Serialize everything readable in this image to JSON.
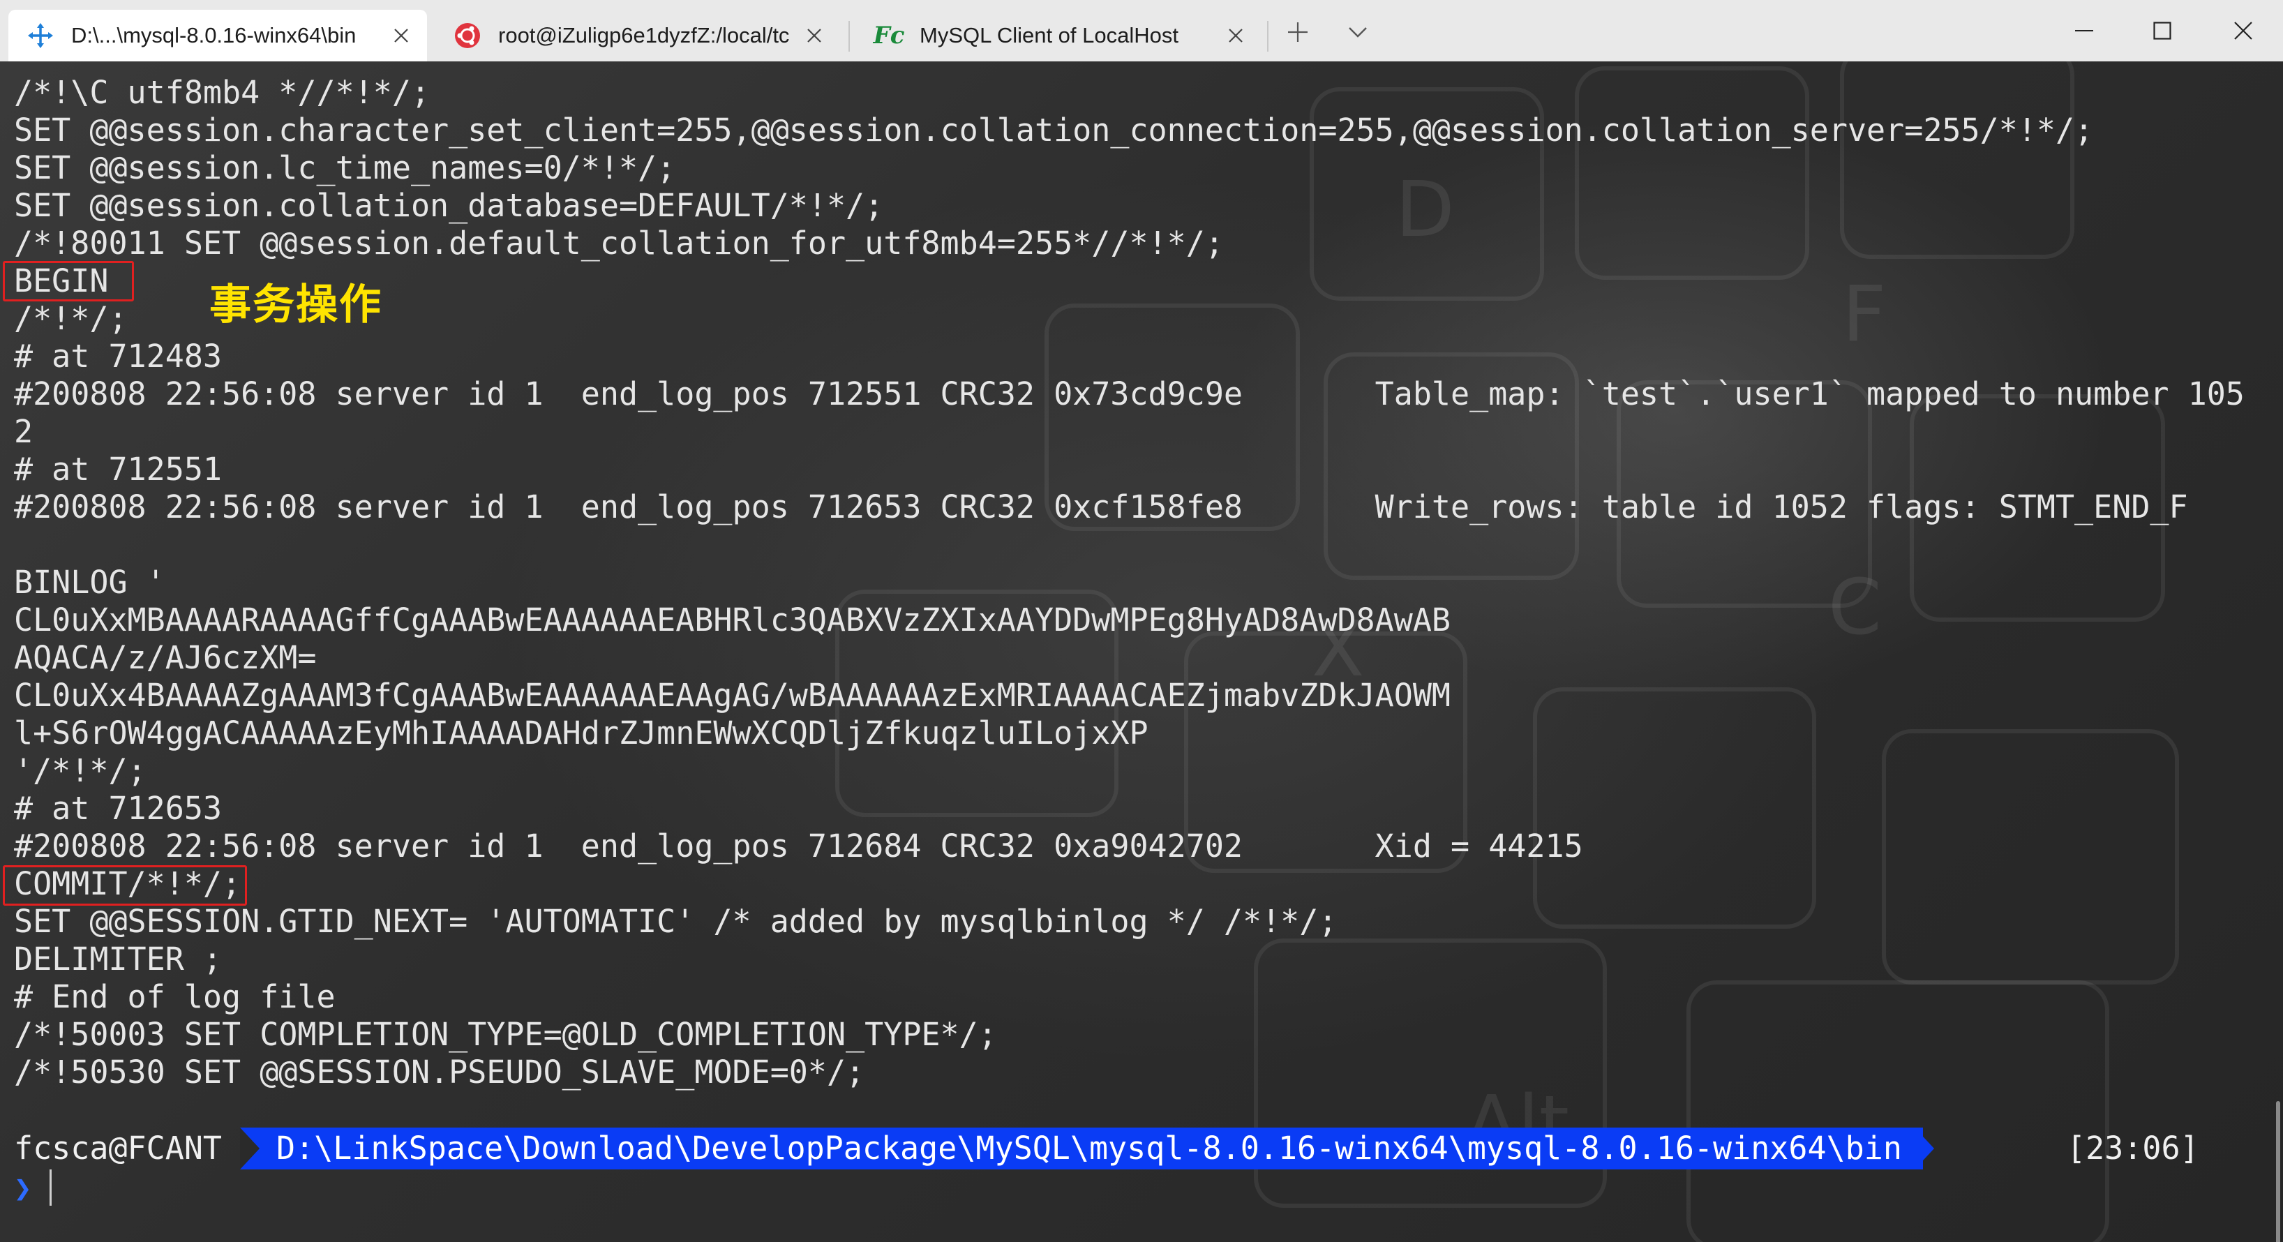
{
  "tabs": [
    {
      "label": "D:\\...\\mysql-8.0.16-winx64\\bin",
      "icon": "move-arrows-icon",
      "active": true
    },
    {
      "label": "root@iZuligp6e1dyzfZ:/local/tc",
      "icon": "ubuntu-icon",
      "active": false
    },
    {
      "label": "MySQL Client of LocalHost",
      "icon": "fc-logo-icon",
      "fc_text": "Fc",
      "active": false
    }
  ],
  "tabbar": {
    "new_tab": "+",
    "dropdown": "⌵"
  },
  "window": {
    "minimize": "—",
    "maximize": "☐",
    "close": "✕"
  },
  "terminal_lines": [
    "/*!\\C utf8mb4 *//*!*/;",
    "SET @@session.character_set_client=255,@@session.collation_connection=255,@@session.collation_server=255/*!*/;",
    "SET @@session.lc_time_names=0/*!*/;",
    "SET @@session.collation_database=DEFAULT/*!*/;",
    "/*!80011 SET @@session.default_collation_for_utf8mb4=255*//*!*/;",
    "BEGIN",
    "/*!*/;",
    "# at 712483",
    "#200808 22:56:08 server id 1  end_log_pos 712551 CRC32 0x73cd9c9e       Table_map: `test`.`user1` mapped to number 105",
    "2",
    "# at 712551",
    "#200808 22:56:08 server id 1  end_log_pos 712653 CRC32 0xcf158fe8       Write_rows: table id 1052 flags: STMT_END_F",
    "",
    "BINLOG '",
    "CL0uXxMBAAAARAAAAGffCgAAABwEAAAAAAEABHRlc3QABXVzZXIxAAYDDwMPEg8HyAD8AwD8AwAB",
    "AQACA/z/AJ6czXM=",
    "CL0uXx4BAAAAZgAAAM3fCgAAABwEAAAAAAEAAgAG/wBAAAAAAzExMRIAAAACAEZjmabvZDkJAOWM",
    "l+S6rOW4ggACAAAAAzEyMhIAAAADAHdrZJmnEWwXCQDljZfkuqzluILojxXP",
    "'/*!*/;",
    "# at 712653",
    "#200808 22:56:08 server id 1  end_log_pos 712684 CRC32 0xa9042702       Xid = 44215",
    "COMMIT/*!*/;",
    "SET @@SESSION.GTID_NEXT= 'AUTOMATIC' /* added by mysqlbinlog */ /*!*/;",
    "DELIMITER ;",
    "# End of log file",
    "/*!50003 SET COMPLETION_TYPE=@OLD_COMPLETION_TYPE*/;",
    "/*!50530 SET @@SESSION.PSEUDO_SLAVE_MODE=0*/;"
  ],
  "annotation": "事务操作",
  "prompt": {
    "user": "fcsca@FCANT",
    "path": "D:\\LinkSpace\\Download\\DevelopPackage\\MySQL\\mysql-8.0.16-winx64\\mysql-8.0.16-winx64\\bin",
    "time": "[23:06]",
    "chevron": "❯"
  },
  "colors": {
    "accent_path": "#0a3cf5",
    "highlight_box": "#e02020",
    "annotation": "#ffe400",
    "chevron": "#2d6bff"
  }
}
